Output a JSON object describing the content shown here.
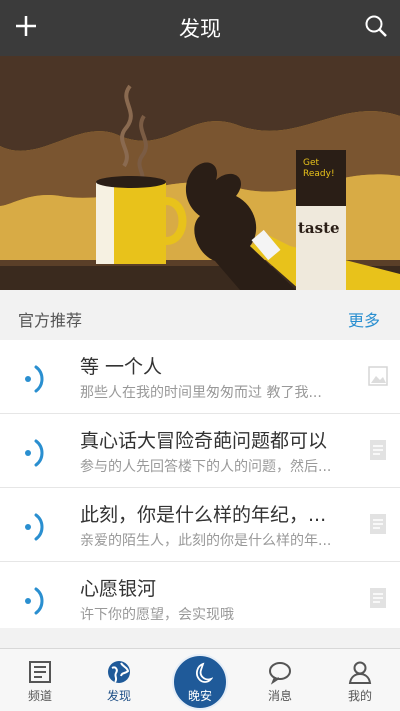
{
  "header": {
    "title": "发现"
  },
  "banner": {
    "card_small_text": "Get Ready!",
    "card_brand": "taste"
  },
  "section": {
    "title": "官方推荐",
    "more": "更多"
  },
  "items": [
    {
      "title": "等 一个人",
      "desc": "那些人在我的时间里匆匆而过 教了我..."
    },
    {
      "title": "真心话大冒险奇葩问题都可以",
      "desc": "参与的人先回答楼下的人的问题，然后..."
    },
    {
      "title": "此刻，你是什么样的年纪，...",
      "desc": "亲爱的陌生人，此刻的你是什么样的年..."
    },
    {
      "title": "心愿银河",
      "desc": "许下你的愿望，会实现哦"
    }
  ],
  "tabs": [
    {
      "label": "频道",
      "icon": "channel-icon"
    },
    {
      "label": "发现",
      "icon": "globe-icon"
    },
    {
      "label": "晚安",
      "icon": "moon-icon"
    },
    {
      "label": "消息",
      "icon": "chat-bubble-icon"
    },
    {
      "label": "我的",
      "icon": "person-icon"
    }
  ],
  "colors": {
    "topbar": "#3b3b3b",
    "accent": "#2a8fd0",
    "tab_active": "#1f5a99"
  }
}
